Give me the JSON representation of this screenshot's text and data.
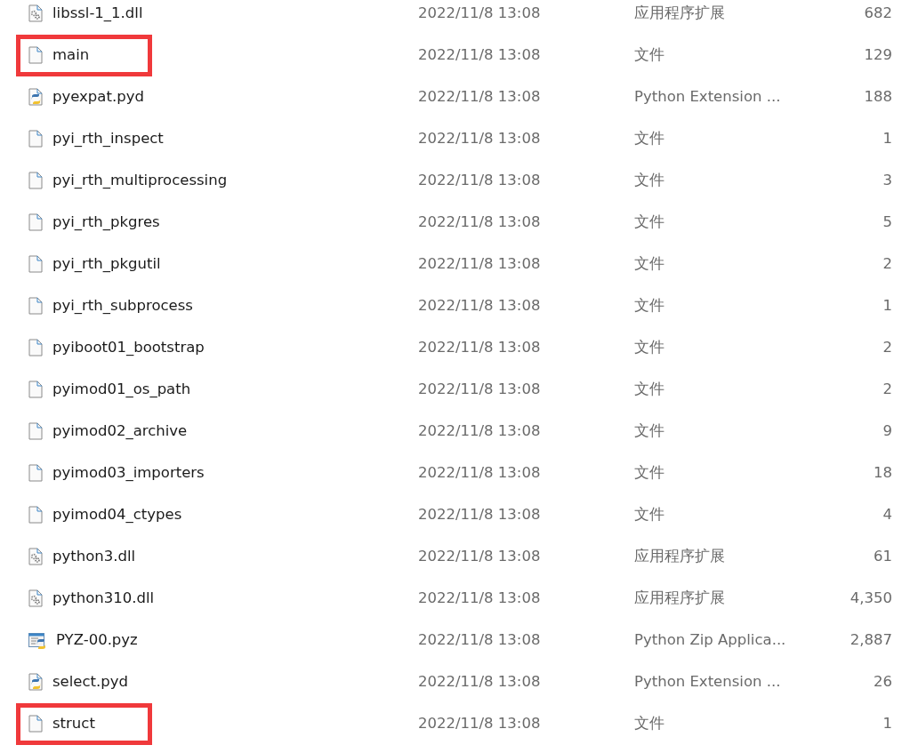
{
  "files": [
    {
      "name": "libssl-1_1.dll",
      "modified": "2022/11/8 13:08",
      "type": "应用程序扩展",
      "size": "682",
      "kind": "dll",
      "highlighted": false
    },
    {
      "name": "main",
      "modified": "2022/11/8 13:08",
      "type": "文件",
      "size": "129",
      "kind": "file",
      "highlighted": true
    },
    {
      "name": "pyexpat.pyd",
      "modified": "2022/11/8 13:08",
      "type": "Python Extension ...",
      "size": "188",
      "kind": "python",
      "highlighted": false
    },
    {
      "name": "pyi_rth_inspect",
      "modified": "2022/11/8 13:08",
      "type": "文件",
      "size": "1",
      "kind": "file",
      "highlighted": false
    },
    {
      "name": "pyi_rth_multiprocessing",
      "modified": "2022/11/8 13:08",
      "type": "文件",
      "size": "3",
      "kind": "file",
      "highlighted": false
    },
    {
      "name": "pyi_rth_pkgres",
      "modified": "2022/11/8 13:08",
      "type": "文件",
      "size": "5",
      "kind": "file",
      "highlighted": false
    },
    {
      "name": "pyi_rth_pkgutil",
      "modified": "2022/11/8 13:08",
      "type": "文件",
      "size": "2",
      "kind": "file",
      "highlighted": false
    },
    {
      "name": "pyi_rth_subprocess",
      "modified": "2022/11/8 13:08",
      "type": "文件",
      "size": "1",
      "kind": "file",
      "highlighted": false
    },
    {
      "name": "pyiboot01_bootstrap",
      "modified": "2022/11/8 13:08",
      "type": "文件",
      "size": "2",
      "kind": "file",
      "highlighted": false
    },
    {
      "name": "pyimod01_os_path",
      "modified": "2022/11/8 13:08",
      "type": "文件",
      "size": "2",
      "kind": "file",
      "highlighted": false
    },
    {
      "name": "pyimod02_archive",
      "modified": "2022/11/8 13:08",
      "type": "文件",
      "size": "9",
      "kind": "file",
      "highlighted": false
    },
    {
      "name": "pyimod03_importers",
      "modified": "2022/11/8 13:08",
      "type": "文件",
      "size": "18",
      "kind": "file",
      "highlighted": false
    },
    {
      "name": "pyimod04_ctypes",
      "modified": "2022/11/8 13:08",
      "type": "文件",
      "size": "4",
      "kind": "file",
      "highlighted": false
    },
    {
      "name": "python3.dll",
      "modified": "2022/11/8 13:08",
      "type": "应用程序扩展",
      "size": "61",
      "kind": "dll",
      "highlighted": false
    },
    {
      "name": "python310.dll",
      "modified": "2022/11/8 13:08",
      "type": "应用程序扩展",
      "size": "4,350",
      "kind": "dll",
      "highlighted": false
    },
    {
      "name": "PYZ-00.pyz",
      "modified": "2022/11/8 13:08",
      "type": "Python Zip Applica...",
      "size": "2,887",
      "kind": "pyz",
      "highlighted": false
    },
    {
      "name": "select.pyd",
      "modified": "2022/11/8 13:08",
      "type": "Python Extension ...",
      "size": "26",
      "kind": "python",
      "highlighted": false
    },
    {
      "name": "struct",
      "modified": "2022/11/8 13:08",
      "type": "文件",
      "size": "1",
      "kind": "file",
      "highlighted": true
    }
  ]
}
